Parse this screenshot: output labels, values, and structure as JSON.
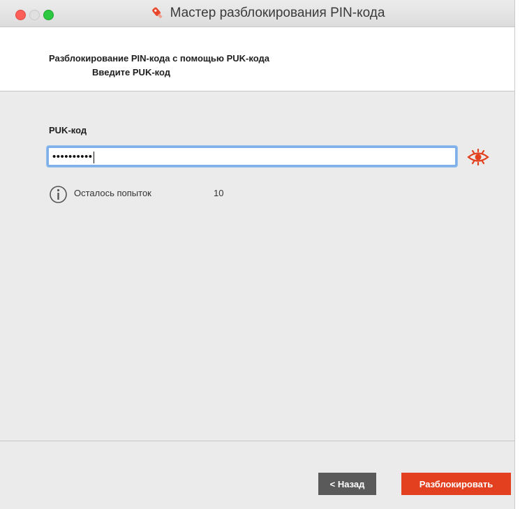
{
  "window": {
    "title": "Мастер разблокирования PIN-кода",
    "title_icon": "key-icon"
  },
  "header": {
    "main": "Разблокирование PIN-кода с помощью PUK-кода",
    "sub": "Введите PUK-код"
  },
  "form": {
    "puk_label": "PUK-код",
    "puk_value": "••••••••••",
    "show_password_icon": "eye-icon",
    "attempts_label": "Осталось попыток",
    "attempts_value": "10"
  },
  "footer": {
    "back_label": "< Назад",
    "unlock_label": "Разблокировать"
  },
  "colors": {
    "accent": "#e2401f",
    "back_button": "#5a5a5a",
    "focus_ring": "#7fb0ea"
  }
}
